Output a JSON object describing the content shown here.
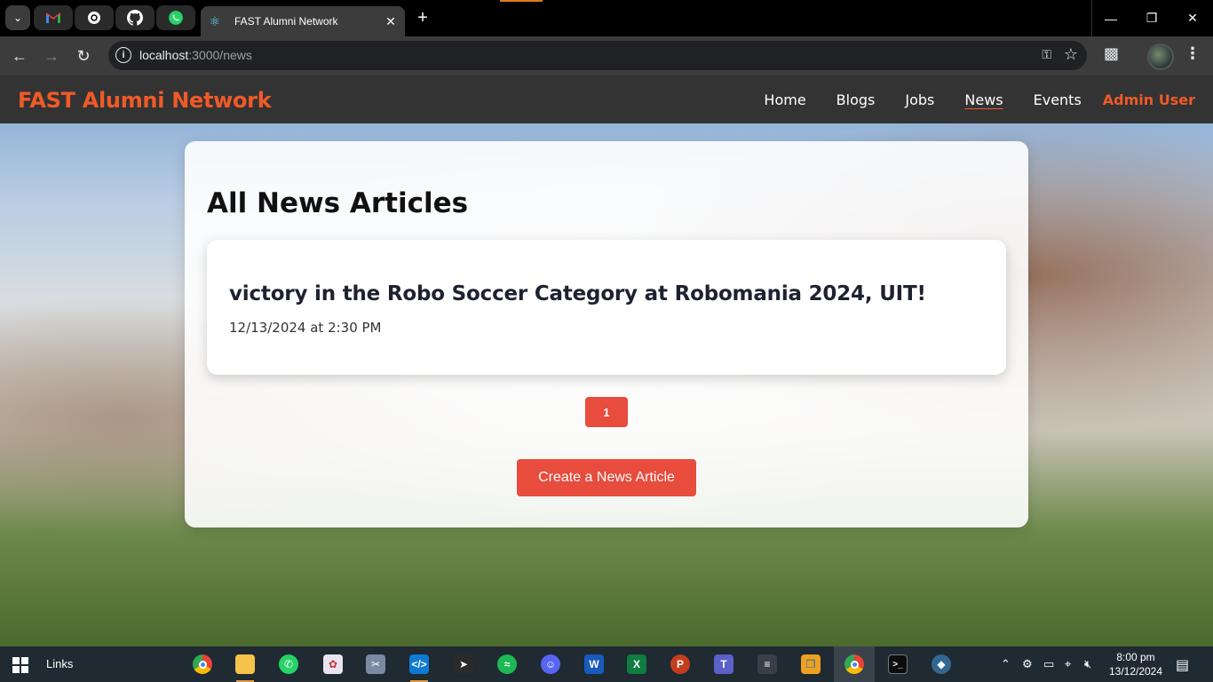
{
  "browser": {
    "tab_title": "FAST Alumni Network",
    "url_host": "localhost",
    "url_path": ":3000/news",
    "pinned_tabs": [
      "gmail-icon",
      "chatgpt-icon",
      "github-icon",
      "whatsapp-icon"
    ]
  },
  "site": {
    "brand": "FAST Alumni Network",
    "nav": {
      "home": "Home",
      "blogs": "Blogs",
      "jobs": "Jobs",
      "news": "News",
      "events": "Events",
      "user": "Admin User"
    },
    "accent_color": "#f05a28",
    "button_color": "#e74c3c"
  },
  "main": {
    "title": "All News Articles",
    "articles": [
      {
        "title": "victory in the Robo Soccer Category at Robomania 2024, UIT!",
        "date": "12/13/2024 at 2:30 PM"
      }
    ],
    "pagination": {
      "current_page": "1"
    },
    "create_button": "Create a News Article"
  },
  "taskbar": {
    "links_label": "Links",
    "time": "8:00 pm",
    "date": "13/12/2024"
  }
}
